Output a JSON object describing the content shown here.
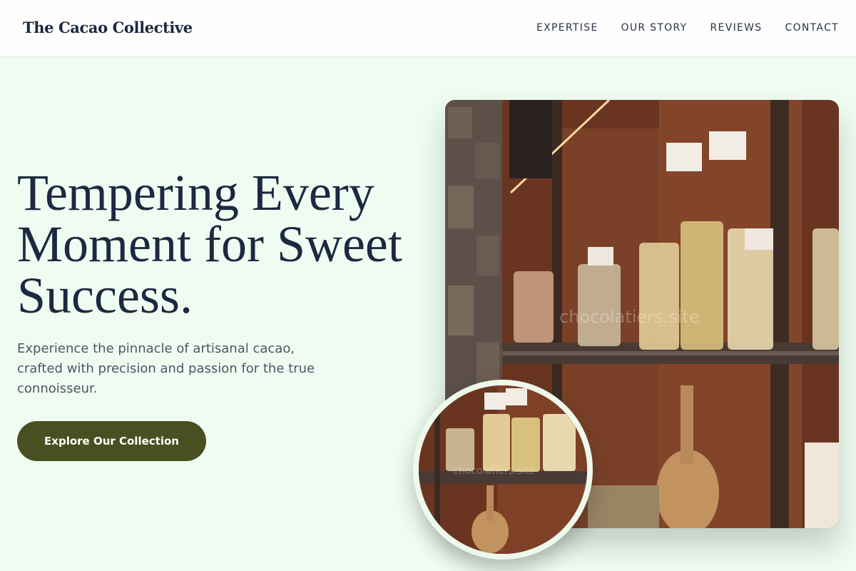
{
  "header": {
    "brand": "The Cacao Collective",
    "nav": [
      "EXPERTISE",
      "OUR STORY",
      "REVIEWS",
      "CONTACT"
    ]
  },
  "hero": {
    "headline": "Tempering Every Moment for Sweet Success.",
    "subtext": "Experience the pinnacle of artisanal cacao, crafted with precision and passion for the true connoisseur.",
    "cta_label": "Explore Our Collection"
  },
  "images": {
    "main_watermark": "chocolatiers.site",
    "inset_watermark": "chocolatiers.site"
  },
  "colors": {
    "page_background": "#effcf1",
    "header_background": "#fdfefd",
    "heading_text": "#1c2940",
    "body_text": "#4c5666",
    "button_background": "#4a4f22",
    "button_text": "#ffffff"
  }
}
